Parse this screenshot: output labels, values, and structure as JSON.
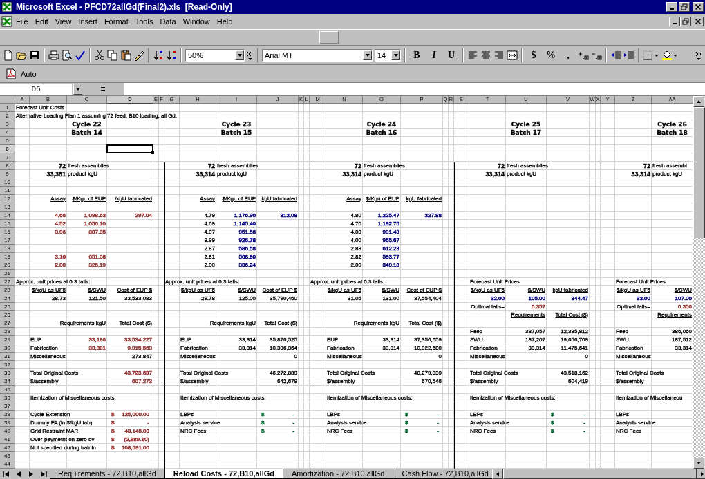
{
  "window": {
    "title": "Microsoft Excel - PFCD72allGd(Final2).xls  [Read-Only]"
  },
  "menu": [
    "File",
    "Edit",
    "View",
    "Insert",
    "Format",
    "Tools",
    "Data",
    "Window",
    "Help"
  ],
  "toolbar": {
    "zoom": "50%",
    "font": "Arial MT",
    "size": "14",
    "style_buttons": [
      "B",
      "I",
      "U"
    ],
    "number_buttons": [
      "$",
      "%",
      ","
    ]
  },
  "pdf_toolbar": {
    "button": "Auto"
  },
  "formula_bar": {
    "name_box": "D6",
    "equals": "="
  },
  "columns": [
    {
      "label": "A",
      "selected": false
    },
    {
      "label": "B",
      "selected": false
    },
    {
      "label": "C",
      "selected": false
    },
    {
      "label": "D",
      "selected": true
    },
    {
      "label": "E",
      "selected": false
    },
    {
      "label": "F",
      "selected": false
    },
    {
      "label": "G",
      "selected": false
    },
    {
      "label": "H",
      "selected": false
    },
    {
      "label": "I",
      "selected": false
    },
    {
      "label": "J",
      "selected": false
    },
    {
      "label": "K",
      "selected": false
    },
    {
      "label": "L",
      "selected": false
    },
    {
      "label": "M",
      "selected": false
    },
    {
      "label": "N",
      "selected": false
    },
    {
      "label": "O",
      "selected": false
    },
    {
      "label": "P",
      "selected": false
    },
    {
      "label": "Q",
      "selected": false
    },
    {
      "label": "R",
      "selected": false
    },
    {
      "label": "S",
      "selected": false
    },
    {
      "label": "T",
      "selected": false
    },
    {
      "label": "U",
      "selected": false
    },
    {
      "label": "V",
      "selected": false
    },
    {
      "label": "W",
      "selected": false
    },
    {
      "label": "X",
      "selected": false
    },
    {
      "label": "Y",
      "selected": false
    },
    {
      "label": "Z",
      "selected": false
    },
    {
      "label": "AA",
      "selected": false
    }
  ],
  "rows": [
    {
      "n": "1",
      "selected": false,
      "cells": {
        "A": {
          "kind": "text",
          "t": "Forecast Unit Costs"
        }
      }
    },
    {
      "n": "2",
      "selected": false,
      "cells": {
        "A": {
          "kind": "text",
          "t": "Alternative Loading Plan 1 assuming 72 feed, B10 loading, all Gd."
        }
      }
    },
    {
      "n": "3",
      "selected": false,
      "cells": {
        "C": {
          "kind": "title",
          "t": "Cycle 22"
        },
        "I": {
          "kind": "title",
          "t": "Cycle 23"
        },
        "O": {
          "kind": "title",
          "t": "Cycle 24"
        },
        "U": {
          "kind": "title",
          "t": "Cycle 25"
        },
        "AA": {
          "kind": "title",
          "t": "Cycle 26"
        }
      }
    },
    {
      "n": "4",
      "selected": false,
      "cells": {
        "C": {
          "kind": "title",
          "t": "Batch 14"
        },
        "I": {
          "kind": "title",
          "t": "Batch 15"
        },
        "O": {
          "kind": "title",
          "t": "Batch 16"
        },
        "U": {
          "kind": "title",
          "t": "Batch 17"
        },
        "AA": {
          "kind": "title",
          "t": "Batch 18"
        }
      }
    },
    {
      "n": "5",
      "selected": false
    },
    {
      "n": "6",
      "selected": true,
      "cells": {
        "D": {
          "selected": true
        }
      }
    },
    {
      "n": "7",
      "selected": false
    },
    {
      "n": "8",
      "selected": false,
      "rule_above": true,
      "cells": {
        "B": {
          "kind": "big",
          "t": "72"
        },
        "C": {
          "kind": "text",
          "t": "fresh assemblies"
        },
        "H": {
          "kind": "big",
          "t": "72"
        },
        "I": {
          "kind": "text",
          "t": "fresh assemblies"
        },
        "N": {
          "kind": "big",
          "t": "72"
        },
        "O": {
          "kind": "text",
          "t": "fresh assemblies"
        },
        "T": {
          "kind": "big",
          "t": "72"
        },
        "U": {
          "kind": "text",
          "t": "fresh assemblies"
        },
        "Z": {
          "kind": "big",
          "t": "72"
        },
        "AA": {
          "kind": "text",
          "t": "fresh assembl"
        }
      }
    },
    {
      "n": "9",
      "selected": false,
      "cells": {
        "B": {
          "kind": "big",
          "t": "33,381"
        },
        "C": {
          "kind": "text",
          "t": "product kgU"
        },
        "H": {
          "kind": "big",
          "t": "33,314"
        },
        "I": {
          "kind": "text",
          "t": "product kgU"
        },
        "N": {
          "kind": "big",
          "t": "33,314"
        },
        "O": {
          "kind": "text",
          "t": "product kgU"
        },
        "T": {
          "kind": "big",
          "t": "33,314"
        },
        "U": {
          "kind": "text",
          "t": "product kgU"
        },
        "Z": {
          "kind": "big",
          "t": "33,314"
        },
        "AA": {
          "kind": "text",
          "t": "product kgU"
        }
      }
    },
    {
      "n": "10",
      "selected": false
    },
    {
      "n": "11",
      "selected": false
    },
    {
      "n": "12",
      "selected": false,
      "cells": {
        "B": {
          "kind": "head",
          "t": "Assay"
        },
        "C": {
          "kind": "head",
          "t": "$/Kgu of EUP"
        },
        "D": {
          "kind": "head",
          "t": "/kgU fabricated"
        },
        "H": {
          "kind": "head",
          "t": "Assay"
        },
        "I": {
          "kind": "head",
          "t": "$/Kgu of EUP"
        },
        "J": {
          "kind": "head",
          "t": "kgU fabricated"
        },
        "N": {
          "kind": "head",
          "t": "Assay"
        },
        "O": {
          "kind": "head",
          "t": "$/Kgu of EUP"
        },
        "P": {
          "kind": "head",
          "t": "kgU fabricated"
        }
      }
    },
    {
      "n": "13",
      "selected": false
    },
    {
      "n": "14",
      "selected": false,
      "cells": {
        "B": {
          "kind": "num",
          "t": "4.66",
          "color": "#993333"
        },
        "C": {
          "kind": "num",
          "t": "1,098.63",
          "color": "#993333"
        },
        "D": {
          "kind": "num",
          "t": "297.04",
          "color": "#993333"
        },
        "H": {
          "kind": "num",
          "t": "4.79"
        },
        "I": {
          "kind": "num",
          "t": "1,176.90",
          "color": "#000080"
        },
        "J": {
          "kind": "num",
          "t": "312.08",
          "color": "#000080"
        },
        "N": {
          "kind": "num",
          "t": "4.80"
        },
        "O": {
          "kind": "num",
          "t": "1,225.47",
          "color": "#000080"
        },
        "P": {
          "kind": "num",
          "t": "327.88",
          "color": "#000080"
        }
      }
    },
    {
      "n": "15",
      "selected": false,
      "cells": {
        "B": {
          "kind": "num",
          "t": "4.52",
          "color": "#993333"
        },
        "C": {
          "kind": "num",
          "t": "1,056.10",
          "color": "#993333"
        },
        "H": {
          "kind": "num",
          "t": "4.69"
        },
        "I": {
          "kind": "num",
          "t": "1,145.40",
          "color": "#000080"
        },
        "N": {
          "kind": "num",
          "t": "4.70"
        },
        "O": {
          "kind": "num",
          "t": "1,192.75",
          "color": "#000080"
        }
      }
    },
    {
      "n": "16",
      "selected": false,
      "cells": {
        "B": {
          "kind": "num",
          "t": "3.96",
          "color": "#993333"
        },
        "C": {
          "kind": "num",
          "t": "887.35",
          "color": "#993333"
        },
        "H": {
          "kind": "num",
          "t": "4.07"
        },
        "I": {
          "kind": "num",
          "t": "951.58",
          "color": "#000080"
        },
        "N": {
          "kind": "num",
          "t": "4.08"
        },
        "O": {
          "kind": "num",
          "t": "991.43",
          "color": "#000080"
        }
      }
    },
    {
      "n": "17",
      "selected": false,
      "cells": {
        "H": {
          "kind": "num",
          "t": "3.99"
        },
        "I": {
          "kind": "num",
          "t": "926.78",
          "color": "#000080"
        },
        "N": {
          "kind": "num",
          "t": "4.00"
        },
        "O": {
          "kind": "num",
          "t": "965.67",
          "color": "#000080"
        }
      }
    },
    {
      "n": "18",
      "selected": false,
      "cells": {
        "H": {
          "kind": "num",
          "t": "2.87"
        },
        "I": {
          "kind": "num",
          "t": "586.58",
          "color": "#000080"
        },
        "N": {
          "kind": "num",
          "t": "2.88"
        },
        "O": {
          "kind": "num",
          "t": "612.23",
          "color": "#000080"
        }
      }
    },
    {
      "n": "19",
      "selected": false,
      "cells": {
        "B": {
          "kind": "num",
          "t": "3.16",
          "color": "#993333"
        },
        "C": {
          "kind": "num",
          "t": "651.08",
          "color": "#993333"
        },
        "H": {
          "kind": "num",
          "t": "2.81"
        },
        "I": {
          "kind": "num",
          "t": "568.80",
          "color": "#000080"
        },
        "N": {
          "kind": "num",
          "t": "2.82"
        },
        "O": {
          "kind": "num",
          "t": "593.77",
          "color": "#000080"
        }
      }
    },
    {
      "n": "20",
      "selected": false,
      "cells": {
        "B": {
          "kind": "num",
          "t": "2.00",
          "color": "#993333"
        },
        "C": {
          "kind": "num",
          "t": "325.19",
          "color": "#993333"
        },
        "H": {
          "kind": "num",
          "t": "2.00"
        },
        "I": {
          "kind": "num",
          "t": "336.24",
          "color": "#000080"
        },
        "N": {
          "kind": "num",
          "t": "2.00"
        },
        "O": {
          "kind": "num",
          "t": "349.18",
          "color": "#000080"
        }
      }
    },
    {
      "n": "21",
      "selected": false
    },
    {
      "n": "22",
      "selected": false,
      "cells": {
        "A": {
          "kind": "text",
          "t": "Approx. unit prices at 0.3 tails:"
        },
        "G": {
          "kind": "text",
          "t": "Approx. unit prices at 0.3 tails:"
        },
        "M": {
          "kind": "text",
          "t": "Approx. unit prices at 0.3 tails:"
        },
        "T": {
          "kind": "text",
          "t": "Forecast Unit Prices"
        },
        "Z": {
          "kind": "text",
          "t": "Forecast Unit Prices"
        }
      }
    },
    {
      "n": "23",
      "selected": false,
      "cells": {
        "B": {
          "kind": "head",
          "t": "$/kgU as UF6"
        },
        "C": {
          "kind": "head",
          "t": "$/SWU"
        },
        "D": {
          "kind": "head",
          "t": "Cost of EUP $"
        },
        "H": {
          "kind": "head",
          "t": "$/kgU as UF6"
        },
        "I": {
          "kind": "head",
          "t": "$/SWU"
        },
        "J": {
          "kind": "head",
          "t": "Cost of EUP $"
        },
        "N": {
          "kind": "head",
          "t": "$/kgU as UF6"
        },
        "O": {
          "kind": "head",
          "t": "$/SWU"
        },
        "P": {
          "kind": "head",
          "t": "Cost of EUP $"
        },
        "T": {
          "kind": "head",
          "t": "$/kgU as UF6"
        },
        "U": {
          "kind": "head",
          "t": "$/SWU"
        },
        "V": {
          "kind": "head",
          "t": "kgU fabricated"
        },
        "Z": {
          "kind": "head",
          "t": "$/kgU as UF6"
        },
        "AA": {
          "kind": "head",
          "t": "$/SWU"
        }
      }
    },
    {
      "n": "24",
      "selected": false,
      "cells": {
        "B": {
          "kind": "num",
          "t": "28.73"
        },
        "C": {
          "kind": "num",
          "t": "121.50"
        },
        "D": {
          "kind": "num",
          "t": "33,533,083"
        },
        "H": {
          "kind": "num",
          "t": "29.78"
        },
        "I": {
          "kind": "num",
          "t": "125.00"
        },
        "J": {
          "kind": "num",
          "t": "35,790,460"
        },
        "N": {
          "kind": "num",
          "t": "31.05"
        },
        "O": {
          "kind": "num",
          "t": "131.00"
        },
        "P": {
          "kind": "num",
          "t": "37,554,404"
        },
        "T": {
          "kind": "num",
          "t": "32.00",
          "color": "#000080"
        },
        "U": {
          "kind": "num",
          "t": "105.00",
          "color": "#000080"
        },
        "V": {
          "kind": "num",
          "t": "344.47",
          "color": "#000080"
        },
        "Z": {
          "kind": "num",
          "t": "33.00",
          "color": "#000080"
        },
        "AA": {
          "kind": "num",
          "t": "107.00",
          "color": "#000080"
        }
      }
    },
    {
      "n": "25",
      "selected": false,
      "cells": {
        "T": {
          "kind": "rlabel",
          "t": "Optimal tails="
        },
        "U": {
          "kind": "num",
          "t": "0.357",
          "color": "#993333"
        },
        "Z": {
          "kind": "rlabel",
          "t": "Optimal tails="
        },
        "AA": {
          "kind": "num",
          "t": "0.356",
          "color": "#993333"
        }
      }
    },
    {
      "n": "26",
      "selected": false,
      "cells": {
        "U": {
          "kind": "head",
          "t": "Requirements"
        },
        "V": {
          "kind": "head",
          "t": "Total Cost ($)"
        },
        "AA": {
          "kind": "head",
          "t": "Requirements"
        }
      }
    },
    {
      "n": "27",
      "selected": false,
      "cells": {
        "C": {
          "kind": "head",
          "t": "Requirements kgU"
        },
        "D": {
          "kind": "head",
          "t": "Total Cost ($)"
        },
        "I": {
          "kind": "head",
          "t": "Requirements kgU"
        },
        "J": {
          "kind": "head",
          "t": "Total Cost ($)"
        },
        "O": {
          "kind": "head",
          "t": "Requirements kgU"
        },
        "P": {
          "kind": "head",
          "t": "Total Cost ($)"
        }
      }
    },
    {
      "n": "28",
      "selected": false,
      "cells": {
        "T": {
          "kind": "text",
          "t": "Feed"
        },
        "U": {
          "kind": "num",
          "t": "387,057"
        },
        "V": {
          "kind": "num",
          "t": "12,385,812"
        },
        "Z": {
          "kind": "text",
          "t": "Feed"
        },
        "AA": {
          "kind": "num",
          "t": "386,060"
        }
      }
    },
    {
      "n": "29",
      "selected": false,
      "cells": {
        "B": {
          "kind": "text",
          "t": "EUP"
        },
        "C": {
          "kind": "num",
          "t": "33,186",
          "color": "#993333"
        },
        "D": {
          "kind": "num",
          "t": "33,534,227",
          "color": "#993333"
        },
        "H": {
          "kind": "text",
          "t": "EUP"
        },
        "I": {
          "kind": "num",
          "t": "33,314"
        },
        "J": {
          "kind": "num",
          "t": "35,876,525"
        },
        "N": {
          "kind": "text",
          "t": "EUP"
        },
        "O": {
          "kind": "num",
          "t": "33,314"
        },
        "P": {
          "kind": "num",
          "t": "37,356,659"
        },
        "T": {
          "kind": "text",
          "t": "SWU"
        },
        "U": {
          "kind": "num",
          "t": "187,207"
        },
        "V": {
          "kind": "num",
          "t": "19,656,709"
        },
        "Z": {
          "kind": "text",
          "t": "SWU"
        },
        "AA": {
          "kind": "num",
          "t": "187,512"
        }
      }
    },
    {
      "n": "30",
      "selected": false,
      "cells": {
        "B": {
          "kind": "text",
          "t": "Fabrication"
        },
        "C": {
          "kind": "num",
          "t": "33,381",
          "color": "#993333"
        },
        "D": {
          "kind": "num",
          "t": "9,915,563",
          "color": "#993333"
        },
        "H": {
          "kind": "text",
          "t": "Fabrication"
        },
        "I": {
          "kind": "num",
          "t": "33,314"
        },
        "J": {
          "kind": "num",
          "t": "10,396,364"
        },
        "N": {
          "kind": "text",
          "t": "Fabrication"
        },
        "O": {
          "kind": "num",
          "t": "33,314"
        },
        "P": {
          "kind": "num",
          "t": "10,922,680"
        },
        "T": {
          "kind": "text",
          "t": "Fabrication"
        },
        "U": {
          "kind": "num",
          "t": "33,314"
        },
        "V": {
          "kind": "num",
          "t": "11,475,641"
        },
        "Z": {
          "kind": "text",
          "t": "Fabrication"
        },
        "AA": {
          "kind": "num",
          "t": "33,314"
        }
      }
    },
    {
      "n": "31",
      "selected": false,
      "cells": {
        "B": {
          "kind": "text",
          "t": "Miscellaneous"
        },
        "D": {
          "kind": "num",
          "t": "273,847"
        },
        "H": {
          "kind": "text",
          "t": "Miscellaneous"
        },
        "J": {
          "kind": "num",
          "t": "0"
        },
        "N": {
          "kind": "text",
          "t": "Miscellaneous"
        },
        "P": {
          "kind": "num",
          "t": "0"
        },
        "T": {
          "kind": "text",
          "t": "Miscellaneous"
        },
        "V": {
          "kind": "num",
          "t": "0"
        },
        "Z": {
          "kind": "text",
          "t": "Miscellaneous"
        }
      }
    },
    {
      "n": "32",
      "selected": false
    },
    {
      "n": "33",
      "selected": false,
      "cells": {
        "B": {
          "kind": "text",
          "t": "Total Original Costs"
        },
        "D": {
          "kind": "num",
          "t": "43,723,637",
          "color": "#993333"
        },
        "H": {
          "kind": "text",
          "t": "Total Original Costs"
        },
        "J": {
          "kind": "num",
          "t": "46,272,889"
        },
        "N": {
          "kind": "text",
          "t": "Total Original Costs"
        },
        "P": {
          "kind": "num",
          "t": "48,279,339"
        },
        "T": {
          "kind": "text",
          "t": "Total Original Costs"
        },
        "V": {
          "kind": "num",
          "t": "43,518,162"
        },
        "Z": {
          "kind": "text",
          "t": "Total Original Costs"
        }
      }
    },
    {
      "n": "34",
      "selected": false,
      "cells": {
        "B": {
          "kind": "text",
          "t": "$/assembly"
        },
        "D": {
          "kind": "num",
          "t": "607,273",
          "color": "#993333"
        },
        "H": {
          "kind": "text",
          "t": "$/assembly"
        },
        "J": {
          "kind": "num",
          "t": "642,679"
        },
        "N": {
          "kind": "text",
          "t": "$/assembly"
        },
        "P": {
          "kind": "num",
          "t": "670,546"
        },
        "T": {
          "kind": "text",
          "t": "$/assembly"
        },
        "V": {
          "kind": "num",
          "t": "604,419"
        },
        "Z": {
          "kind": "text",
          "t": "$/assembly"
        }
      }
    },
    {
      "n": "35",
      "selected": false,
      "rule_above": true
    },
    {
      "n": "36",
      "selected": false,
      "cells": {
        "B": {
          "kind": "text",
          "t": "Itemization of Miscellaneous costs:"
        },
        "H": {
          "kind": "text",
          "t": "Itemization of Miscellaneous costs:"
        },
        "N": {
          "kind": "text",
          "t": "Itemization of Miscellaneous costs:"
        },
        "T": {
          "kind": "text",
          "t": "Itemization of Miscellaneous costs:"
        },
        "Z": {
          "kind": "text",
          "t": "Itemization of Miscellaneou"
        }
      }
    },
    {
      "n": "37",
      "selected": false
    },
    {
      "n": "38",
      "selected": false,
      "cells": {
        "B": {
          "kind": "text",
          "t": "Cycle Extension"
        },
        "D": {
          "kind": "acct",
          "currency": "$",
          "t": "125,000.00",
          "color": "#993333"
        },
        "H": {
          "kind": "text",
          "t": "LBPs"
        },
        "J": {
          "kind": "acct",
          "currency": "$",
          "t": "-",
          "color": "#006633"
        },
        "N": {
          "kind": "text",
          "t": "LBPs"
        },
        "P": {
          "kind": "acct",
          "currency": "$",
          "t": "-",
          "color": "#006633"
        },
        "T": {
          "kind": "text",
          "t": "LBPs"
        },
        "V": {
          "kind": "acct",
          "currency": "$",
          "t": "-",
          "color": "#006633"
        },
        "Z": {
          "kind": "text",
          "t": "LBPs"
        }
      }
    },
    {
      "n": "39",
      "selected": false,
      "cells": {
        "B": {
          "kind": "text",
          "t": "Dummy FA (in $/kgU fab)"
        },
        "D": {
          "kind": "acct",
          "currency": "$",
          "t": "-",
          "color": "#993333"
        },
        "H": {
          "kind": "text",
          "t": "Analysis service"
        },
        "J": {
          "kind": "acct",
          "currency": "$",
          "t": "-",
          "color": "#006633"
        },
        "N": {
          "kind": "text",
          "t": "Analysis service"
        },
        "P": {
          "kind": "acct",
          "currency": "$",
          "t": "-",
          "color": "#006633"
        },
        "T": {
          "kind": "text",
          "t": "Analysis service"
        },
        "V": {
          "kind": "acct",
          "currency": "$",
          "t": "-",
          "color": "#006633"
        },
        "Z": {
          "kind": "text",
          "t": "Analysis service"
        }
      }
    },
    {
      "n": "40",
      "selected": false,
      "cells": {
        "B": {
          "kind": "text",
          "t": "Grid Restraint MAR"
        },
        "D": {
          "kind": "acct",
          "currency": "$",
          "t": "43,145.00",
          "color": "#993333"
        },
        "H": {
          "kind": "text",
          "t": "NRC Fees"
        },
        "J": {
          "kind": "acct",
          "currency": "$",
          "t": "-",
          "color": "#006633"
        },
        "N": {
          "kind": "text",
          "t": "NRC Fees"
        },
        "P": {
          "kind": "acct",
          "currency": "$",
          "t": "-",
          "color": "#006633"
        },
        "T": {
          "kind": "text",
          "t": "NRC Fees"
        },
        "V": {
          "kind": "acct",
          "currency": "$",
          "t": "-",
          "color": "#006633"
        },
        "Z": {
          "kind": "text",
          "t": "NRC Fees"
        }
      }
    },
    {
      "n": "41",
      "selected": false,
      "cells": {
        "B": {
          "kind": "text",
          "t": "Over-paymetnt on zero ov"
        },
        "D": {
          "kind": "acct",
          "currency": "$",
          "t": "(2,889.10)",
          "color": "#993333"
        }
      }
    },
    {
      "n": "42",
      "selected": false,
      "cells": {
        "B": {
          "kind": "text",
          "t": "Not specified during trainin"
        },
        "D": {
          "kind": "acct",
          "currency": "$",
          "t": "108,591.00",
          "color": "#993333"
        }
      }
    },
    {
      "n": "43",
      "selected": false
    },
    {
      "n": "44",
      "selected": false
    }
  ],
  "sheet_tabs": [
    {
      "label": "Requirements - 72,B10,allGd",
      "selected": false
    },
    {
      "label": "Reload Costs - 72,B10,allGd",
      "selected": true
    },
    {
      "label": "Amortization - 72,B10,allGd",
      "selected": false
    },
    {
      "label": "Cash Flow - 72,B10,allGd",
      "selected": false
    }
  ]
}
